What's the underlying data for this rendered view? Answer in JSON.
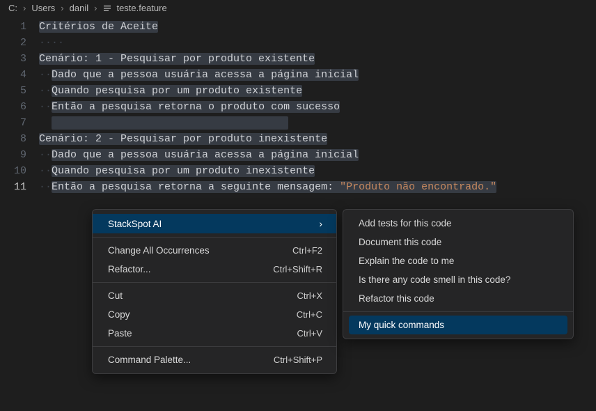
{
  "breadcrumbs": {
    "c": "C:",
    "users": "Users",
    "user": "danil",
    "file": "teste.feature"
  },
  "lines": {
    "l1": "Critérios de Aceite",
    "l3": "Cenário: 1 - Pesquisar por produto existente",
    "l4": "Dado que a pessoa usuária acessa a página inicial",
    "l5": "Quando pesquisa por um produto existente",
    "l6": "Então a pesquisa retorna o produto com sucesso",
    "l8": "Cenário: 2 - Pesquisar por produto inexistente",
    "l9": "Dado que a pessoa usuária acessa a página inicial",
    "l10": "Quando pesquisa por um produto inexistente",
    "l11_a": "Então a pesquisa retorna a seguinte mensagem: ",
    "l11_b": "\"Produto não encontrado.\""
  },
  "lineNumbers": {
    "n1": "1",
    "n2": "2",
    "n3": "3",
    "n4": "4",
    "n5": "5",
    "n6": "6",
    "n7": "7",
    "n8": "8",
    "n9": "9",
    "n10": "10",
    "n11": "11"
  },
  "menu1": {
    "stackspot": "StackSpot AI",
    "changeAll": "Change All Occurrences",
    "changeAll_sc": "Ctrl+F2",
    "refactor": "Refactor...",
    "refactor_sc": "Ctrl+Shift+R",
    "cut": "Cut",
    "cut_sc": "Ctrl+X",
    "copy": "Copy",
    "copy_sc": "Ctrl+C",
    "paste": "Paste",
    "paste_sc": "Ctrl+V",
    "cmdPalette": "Command Palette...",
    "cmdPalette_sc": "Ctrl+Shift+P"
  },
  "menu2": {
    "addTests": "Add tests for this code",
    "document": "Document this code",
    "explain": "Explain the code to me",
    "codeSmell": "Is there any code smell in this code?",
    "refactorThis": "Refactor this code",
    "myQuick": "My quick commands"
  }
}
